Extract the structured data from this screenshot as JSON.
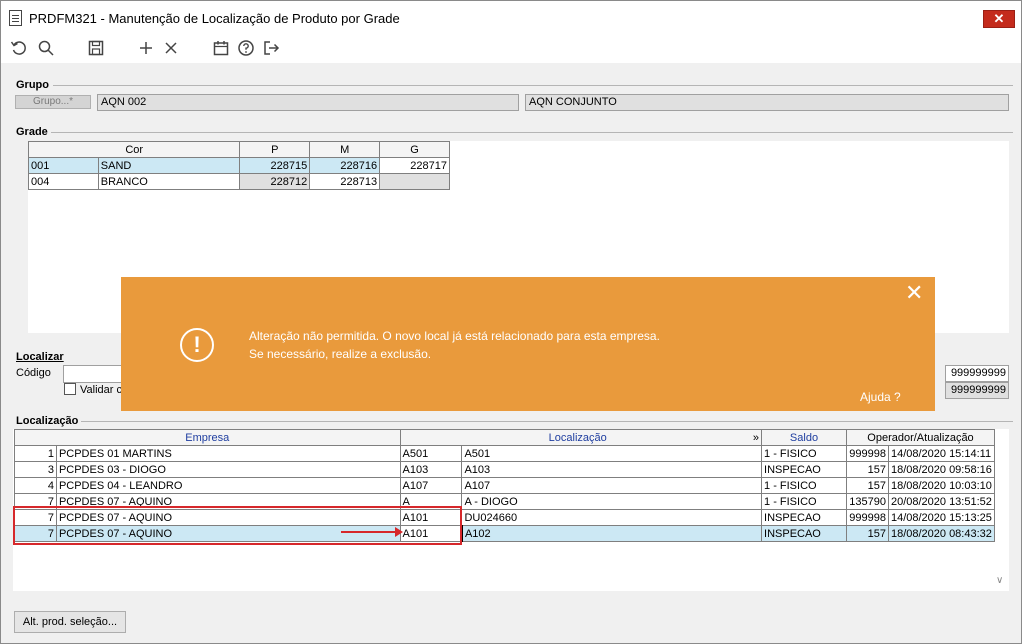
{
  "window": {
    "title": "PRDFM321 - Manutenção de Localização de Produto por Grade",
    "close": "✕"
  },
  "toolbar": {
    "icons": [
      "undo-icon",
      "search-icon",
      "save-icon",
      "add-icon",
      "delete-icon",
      "calendar-icon",
      "help-icon",
      "exit-icon"
    ]
  },
  "grupo": {
    "section": "Grupo",
    "button": "Grupo...*",
    "code": "AQN 002",
    "description": "AQN CONJUNTO"
  },
  "grade": {
    "section": "Grade",
    "headers": [
      "Cor",
      "P",
      "M",
      "G"
    ],
    "rows": [
      {
        "code": "001",
        "cor": "SAND",
        "p": "228715",
        "m": "228716",
        "g": "228717"
      },
      {
        "code": "004",
        "cor": "BRANCO",
        "p": "228712",
        "m": "228713",
        "g": ""
      }
    ]
  },
  "localizar": {
    "section": "Localizar",
    "codigo_label": "Código",
    "validar_label": "Validar c",
    "right_values": [
      "999999999",
      "999999999"
    ]
  },
  "toast": {
    "line1": "Alteração não permitida. O novo local já está relacionado para esta empresa.",
    "line2": "Se necessário, realize a exclusão.",
    "help": "Ajuda ?",
    "close": "✕",
    "icon": "!"
  },
  "localizacao": {
    "section": "Localização",
    "headers": {
      "empresa": "Empresa",
      "localizacao": "Localização",
      "saldo": "Saldo",
      "operador": "Operador/Atualização",
      "expand": "»"
    },
    "rows": [
      {
        "num": "1",
        "empresa": "PCPDES 01 MARTINS",
        "loc": "A501",
        "desc": "A501",
        "saldo": "1 - FISICO",
        "qty": "999998",
        "date": "14/08/2020 15:14:11"
      },
      {
        "num": "3",
        "empresa": "PCPDES 03 - DIOGO",
        "loc": "A103",
        "desc": "A103",
        "saldo": "INSPECAO",
        "qty": "157",
        "date": "18/08/2020 09:58:16"
      },
      {
        "num": "4",
        "empresa": "PCPDES 04 - LEANDRO",
        "loc": "A107",
        "desc": "A107",
        "saldo": "1 - FISICO",
        "qty": "157",
        "date": "18/08/2020 10:03:10"
      },
      {
        "num": "7",
        "empresa": "PCPDES 07 - AQUINO",
        "loc": "A",
        "desc": "A - DIOGO",
        "saldo": "1 - FISICO",
        "qty": "135790",
        "date": "20/08/2020 13:51:52"
      },
      {
        "num": "7",
        "empresa": "PCPDES 07 - AQUINO",
        "loc": "A101",
        "desc": "DU024660",
        "saldo": "INSPECAO",
        "qty": "999998",
        "date": "14/08/2020 15:13:25"
      },
      {
        "num": "7",
        "empresa": "PCPDES 07 - AQUINO",
        "loc": "A101",
        "desc": "A102",
        "saldo": "INSPECAO",
        "qty": "157",
        "date": "18/08/2020 08:43:32"
      }
    ]
  },
  "bottom": {
    "button": "Alt. prod. seleção..."
  },
  "colors": {
    "toast": "#e99a3c",
    "selection": "#cce8f4",
    "highlight": "#d6282b"
  }
}
